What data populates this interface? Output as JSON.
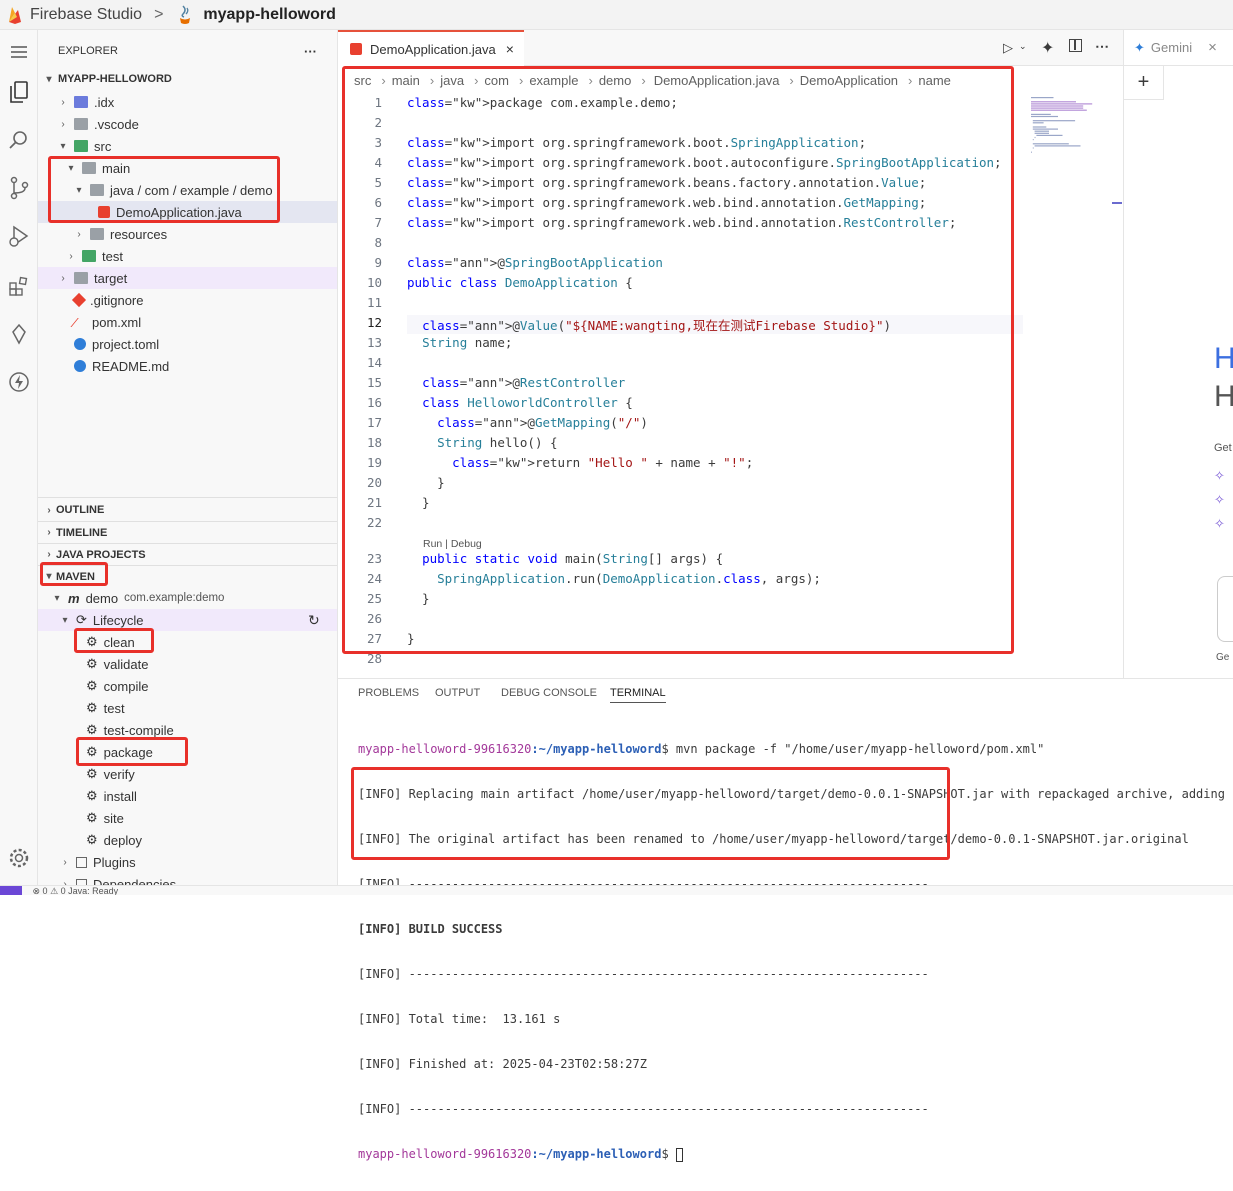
{
  "titlebar": {
    "brand": "Firebase Studio",
    "separator": ">",
    "project": "myapp-helloword"
  },
  "explorer": {
    "title": "EXPLORER",
    "more": "···",
    "root": "MYAPP-HELLOWORD",
    "items": [
      ".idx",
      ".vscode",
      "src",
      "main",
      "java / com / example / demo",
      "DemoApplication.java",
      "resources",
      "test",
      "target",
      ".gitignore",
      "pom.xml",
      "project.toml",
      "README.md"
    ]
  },
  "sections": {
    "outline": "OUTLINE",
    "timeline": "TIMELINE",
    "java_projects": "JAVA PROJECTS",
    "maven": "MAVEN"
  },
  "maven": {
    "project": "demo",
    "coords": "com.example:demo",
    "lifecycle": "Lifecycle",
    "phases": [
      "clean",
      "validate",
      "compile",
      "test",
      "test-compile",
      "package",
      "verify",
      "install",
      "site",
      "deploy"
    ],
    "plugins": "Plugins",
    "dependencies": "Dependencies"
  },
  "editor": {
    "tab": "DemoApplication.java",
    "breadcrumb": [
      "src",
      "main",
      "java",
      "com",
      "example",
      "demo",
      "DemoApplication.java",
      "DemoApplication",
      "name"
    ],
    "run_debug": "Run | Debug",
    "line_numbers": [
      "1",
      "2",
      "3",
      "4",
      "5",
      "6",
      "7",
      "8",
      "9",
      "10",
      "11",
      "12",
      "13",
      "14",
      "15",
      "16",
      "17",
      "18",
      "19",
      "20",
      "21",
      "22",
      "23",
      "24",
      "25",
      "26",
      "27",
      "28"
    ],
    "lines": [
      "package com.example.demo;",
      "",
      "import org.springframework.boot.SpringApplication;",
      "import org.springframework.boot.autoconfigure.SpringBootApplication;",
      "import org.springframework.beans.factory.annotation.Value;",
      "import org.springframework.web.bind.annotation.GetMapping;",
      "import org.springframework.web.bind.annotation.RestController;",
      "",
      "@SpringBootApplication",
      "public class DemoApplication {",
      "",
      "  @Value(\"${NAME:wangting,现在在测试Firebase Studio}\")",
      "  String name;",
      "",
      "  @RestController",
      "  class HelloworldController {",
      "    @GetMapping(\"/\")",
      "    String hello() {",
      "      return \"Hello \" + name + \"!\";",
      "    }",
      "  }",
      "",
      "  public static void main(String[] args) {",
      "    SpringApplication.run(DemoApplication.class, args);",
      "  }",
      "",
      "}",
      ""
    ]
  },
  "gemini": {
    "tab": "Gemini",
    "close": "×",
    "add": "+",
    "big_h1": "H",
    "big_h2": "H",
    "get": "Get",
    "gen": "Ge"
  },
  "panel": {
    "tabs": [
      "PROBLEMS",
      "OUTPUT",
      "DEBUG CONSOLE",
      "TERMINAL"
    ],
    "prompt_user": "myapp-helloword-99616320",
    "prompt_path": ":~/myapp-helloword",
    "command": "$ mvn package -f \"/home/user/myapp-helloword/pom.xml\"",
    "lines": [
      "[INFO] Replacing main artifact /home/user/myapp-helloword/target/demo-0.0.1-SNAPSHOT.jar with repackaged archive, adding nest",
      "[INFO] The original artifact has been renamed to /home/user/myapp-helloword/target/demo-0.0.1-SNAPSHOT.jar.original",
      "[INFO] ------------------------------------------------------------------------",
      "[INFO] BUILD SUCCESS",
      "[INFO] ------------------------------------------------------------------------",
      "[INFO] Total time:  13.161 s",
      "[INFO] Finished at: 2025-04-23T02:58:27Z",
      "[INFO] ------------------------------------------------------------------------"
    ],
    "prompt_end": "$ "
  },
  "status": {
    "text": "⊗ 0 ⚠ 0   Java: Ready"
  },
  "colors": {
    "highlight_box": "#e8302a",
    "accent": "#e6513b"
  }
}
